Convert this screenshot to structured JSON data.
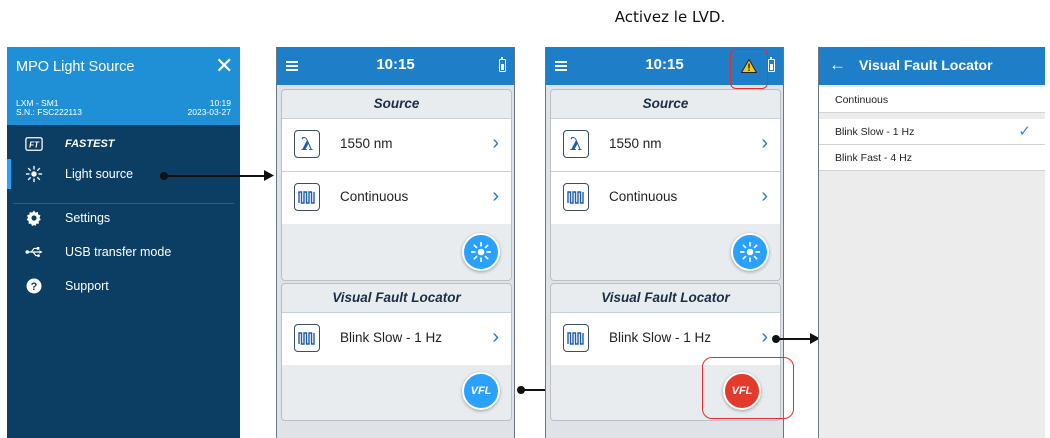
{
  "caption": "Activez le LVD.",
  "menu": {
    "title": "MPO Light Source",
    "model": "LXM - SM1",
    "serial": "S.N.: FSC222113",
    "time": "10:19",
    "date": "2023-03-27",
    "items": [
      {
        "label": "FASTEST",
        "icon": "fastest-icon"
      },
      {
        "label": "Light source",
        "icon": "light-source-icon"
      },
      {
        "label": "Settings",
        "icon": "gear-icon"
      },
      {
        "label": "USB transfer mode",
        "icon": "usb-icon"
      },
      {
        "label": "Support",
        "icon": "help-icon"
      }
    ]
  },
  "phone1": {
    "time": "10:15",
    "source_title": "Source",
    "wavelength": "1550 nm",
    "mode": "Continuous",
    "vfl_title": "Visual Fault Locator",
    "vfl_mode": "Blink Slow - 1 Hz",
    "vfl_button": "VFL",
    "vfl_color": "#2aa1ff"
  },
  "phone2": {
    "time": "10:15",
    "source_title": "Source",
    "wavelength": "1550 nm",
    "mode": "Continuous",
    "vfl_title": "Visual Fault Locator",
    "vfl_mode": "Blink Slow - 1 Hz",
    "vfl_button": "VFL",
    "vfl_color": "#e23b2b"
  },
  "list": {
    "title": "Visual Fault Locator",
    "options": [
      "Continuous",
      "Blink Slow - 1 Hz",
      "Blink Fast - 4 Hz"
    ],
    "selected": "Blink Slow - 1 Hz"
  },
  "colors": {
    "accent": "#1f7ec8",
    "menu_bg": "#0c3e64",
    "highlight": "#e52b2b"
  }
}
